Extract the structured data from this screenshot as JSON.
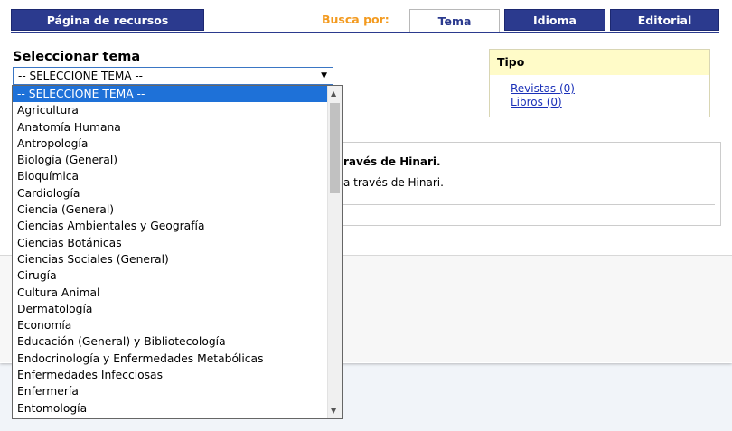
{
  "tabs": {
    "resources": "Página de recursos",
    "search_by": "Busca por:",
    "tema": "Tema",
    "idioma": "Idioma",
    "editorial": "Editorial"
  },
  "select": {
    "title": "Seleccionar tema",
    "value": "-- SELECCIONE TEMA --",
    "options": [
      "-- SELECCIONE TEMA --",
      "Agricultura",
      "Anatomía Humana",
      "Antropología",
      "Biología (General)",
      "Bioquímica",
      "Cardiología",
      "Ciencia (General)",
      "Ciencias Ambientales y Geografía",
      "Ciencias Botánicas",
      "Ciencias Sociales (General)",
      "Cirugía",
      "Cultura Animal",
      "Dermatología",
      "Economía",
      "Educación (General) y Bibliotecología",
      "Endocrinología y Enfermedades Metabólicas",
      "Enfermedades Infecciosas",
      "Enfermería",
      "Entomología"
    ]
  },
  "tipo": {
    "title": "Tipo",
    "revistas": "Revistas (0)",
    "libros": "Libros (0)"
  },
  "results": {
    "title_fragment": "ravés de Hinari.",
    "text_fragment": "a través de Hinari."
  }
}
